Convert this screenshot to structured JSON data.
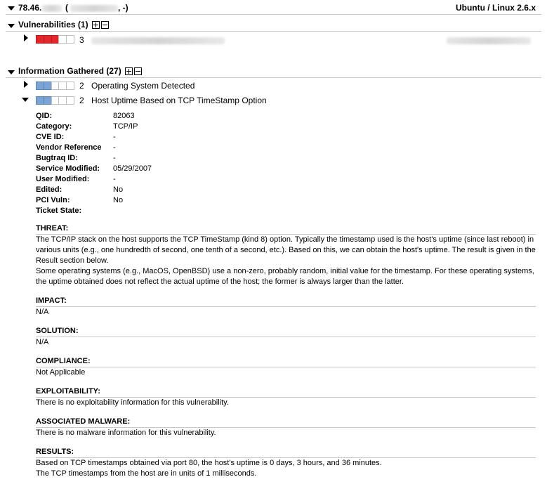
{
  "host": {
    "ip_prefix": "78.46.",
    "hostname_open": "(",
    "hostname_close": ", -)",
    "os": "Ubuntu / Linux 2.6.x"
  },
  "vulnerabilities": {
    "title": "Vulnerabilities (1)",
    "items": [
      {
        "severity": 3,
        "color": "#e3262b",
        "severity_label": "3"
      }
    ]
  },
  "info": {
    "title": "Information Gathered (27)",
    "items": [
      {
        "severity": 2,
        "severity_label": "2",
        "title": "Operating System Detected"
      },
      {
        "severity": 2,
        "severity_label": "2",
        "title": "Host Uptime Based on TCP TimeStamp Option"
      }
    ]
  },
  "details": {
    "qid_label": "QID:",
    "qid": "82063",
    "category_label": "Category:",
    "category": "TCP/IP",
    "cve_label": "CVE ID:",
    "cve": "-",
    "vendor_label": "Vendor Reference",
    "vendor": "-",
    "bugtraq_label": "Bugtraq ID:",
    "bugtraq": "-",
    "service_modified_label": "Service Modified:",
    "service_modified": "05/29/2007",
    "user_modified_label": "User Modified:",
    "user_modified": "-",
    "edited_label": "Edited:",
    "edited": "No",
    "pci_label": "PCI Vuln:",
    "pci": "No",
    "ticket_label": "Ticket State:",
    "ticket": ""
  },
  "sections": {
    "threat_title": "THREAT:",
    "threat_p1": "The TCP/IP stack on the host supports the TCP TimeStamp (kind 8) option. Typically the timestamp used is the host's uptime (since last reboot) in various units (e.g., one hundredth of second, one tenth of a second, etc.). Based on this, we can obtain the host's uptime. The result is given in the Result section below.",
    "threat_p2": "Some operating systems (e.g., MacOS, OpenBSD) use a non-zero, probably random, initial value for the timestamp. For these operating systems, the uptime obtained does not reflect the actual uptime of the host; the former is always larger than the latter.",
    "impact_title": "IMPACT:",
    "impact": "N/A",
    "solution_title": "SOLUTION:",
    "solution": "N/A",
    "compliance_title": "COMPLIANCE:",
    "compliance": "Not Applicable",
    "exploit_title": "EXPLOITABILITY:",
    "exploit": "There is no exploitability information for this vulnerability.",
    "malware_title": "ASSOCIATED MALWARE:",
    "malware": "There is no malware information for this vulnerability.",
    "results_title": "RESULTS:",
    "results_1": "Based on TCP timestamps obtained via port 80, the host's uptime is 0 days, 3 hours, and 36 minutes.",
    "results_2": "The TCP timestamps from the host are in units of 1 milliseconds."
  }
}
